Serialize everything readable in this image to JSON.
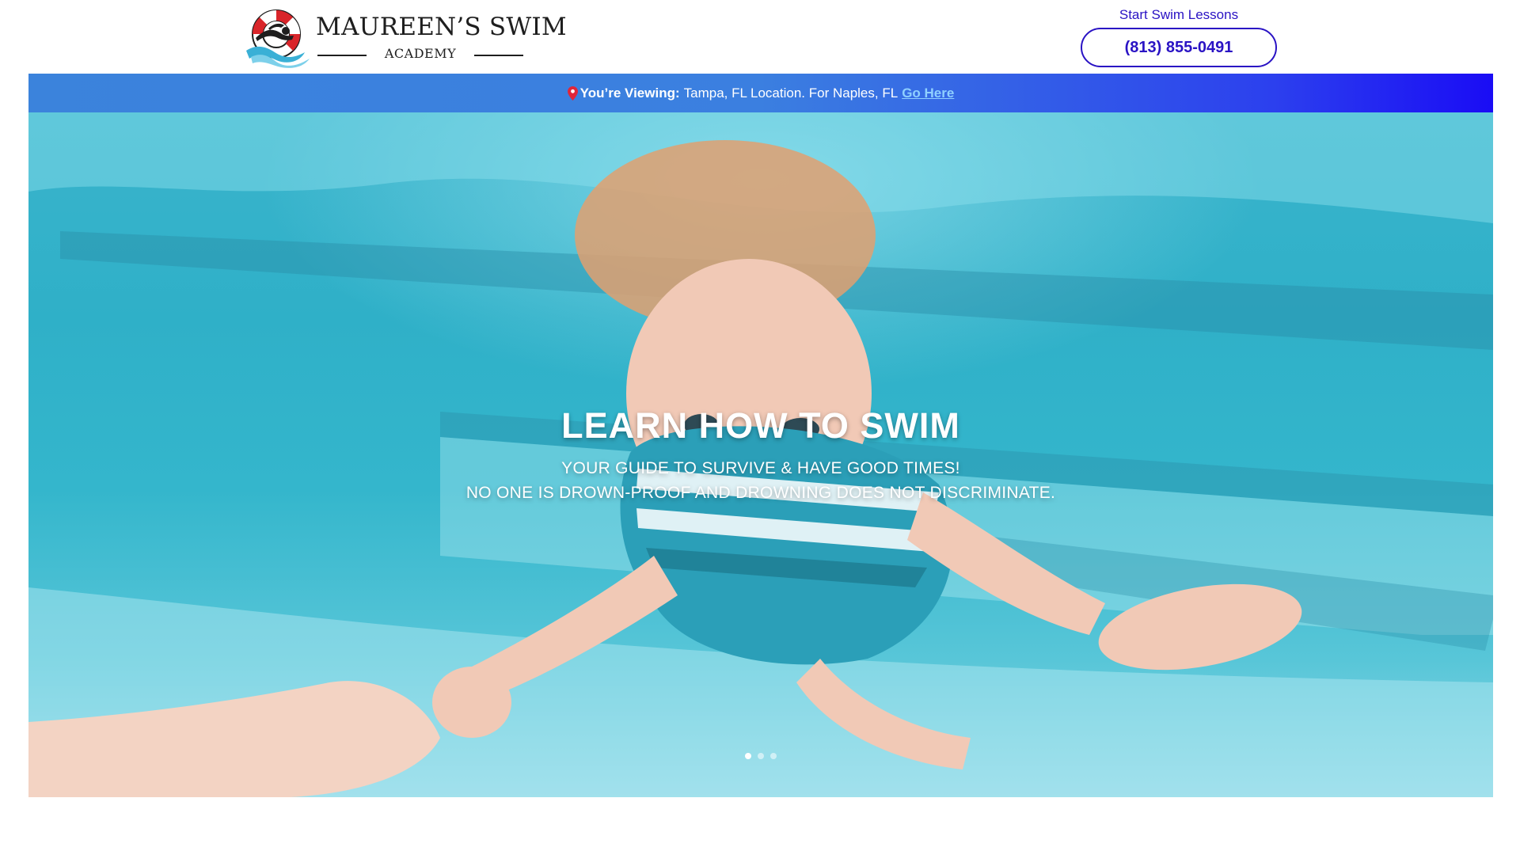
{
  "header": {
    "logo": {
      "name": "MAUREEN’S SWIM",
      "subname": "ACADEMY"
    },
    "cta": {
      "label": "Start Swim Lessons",
      "phone": "(813) 855-0491"
    }
  },
  "location_bar": {
    "icon": "map-pin-icon",
    "prefix": "You’re Viewing:",
    "text": "Tampa, FL Location. For Naples, FL",
    "link": "Go Here"
  },
  "hero": {
    "title": "LEARN HOW TO SWIM",
    "subtitle_line1": "YOUR GUIDE TO SURVIVE & HAVE GOOD TIMES!",
    "subtitle_line2": "NO ONE IS DROWN-PROOF AND DROWNING DOES NOT DISCRIMINATE.",
    "slides_total": 3,
    "active_slide": 1
  },
  "colors": {
    "brand": "#2a13c4",
    "location_bar_start": "#3b83dc",
    "location_bar_end": "#1a0cf5",
    "link": "#8fd0ff",
    "water": "#34b6cc",
    "lifebuoy_red": "#d9252a"
  }
}
